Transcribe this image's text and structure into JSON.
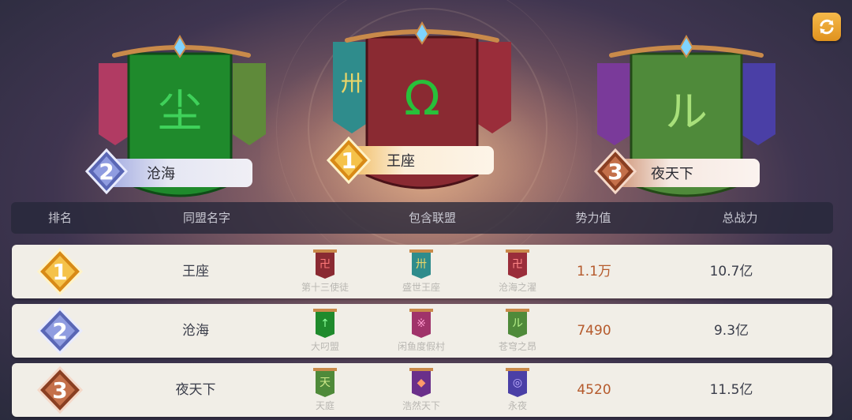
{
  "podium": [
    {
      "rank": "2",
      "name": "沧海",
      "main_glyph": "尘",
      "main_color": "#1f8a2c",
      "glyph_color": "#3fd15a",
      "side_left_color": "#b13b63",
      "side_right_color": "#5f8a3a"
    },
    {
      "rank": "1",
      "name": "王座",
      "main_glyph": "Ω",
      "main_color": "#8a2a32",
      "glyph_color": "#28c03a",
      "side_left_color": "#2f8c8c",
      "side_right_color": "#9a2d3a"
    },
    {
      "rank": "3",
      "name": "夜天下",
      "main_glyph": "ル",
      "main_color": "#4f8a3a",
      "glyph_color": "#a8e07a",
      "side_left_color": "#7a3a9a",
      "side_right_color": "#4a3fa6"
    }
  ],
  "table": {
    "headers": {
      "rank": "排名",
      "alliance_name": "同盟名字",
      "members": "包含联盟",
      "power": "势力值",
      "combat": "总战力"
    },
    "rows": [
      {
        "rank": "1",
        "name": "王座",
        "power": "1.1万",
        "combat": "10.7亿",
        "members": [
          {
            "label": "第十三使徒",
            "color": "#8a2a32",
            "glyph_color": "#ff7a7a"
          },
          {
            "label": "盛世王座",
            "color": "#2f8c8c",
            "glyph_color": "#e7d46a"
          },
          {
            "label": "沧海之濯",
            "color": "#9a2d3a",
            "glyph_color": "#ff8888"
          }
        ]
      },
      {
        "rank": "2",
        "name": "沧海",
        "power": "7490",
        "combat": "9.3亿",
        "members": [
          {
            "label": "大叼盟",
            "color": "#1f8a2c",
            "glyph_color": "#8cff9a"
          },
          {
            "label": "闲鱼度假村",
            "color": "#a0336a",
            "glyph_color": "#ff9ad0"
          },
          {
            "label": "苍穹之昂",
            "color": "#4f8a3a",
            "glyph_color": "#b6f08a"
          }
        ]
      },
      {
        "rank": "3",
        "name": "夜天下",
        "power": "4520",
        "combat": "11.5亿",
        "members": [
          {
            "label": "天庭",
            "color": "#4f8a3a",
            "glyph_color": "#cfe98a"
          },
          {
            "label": "浩然天下",
            "color": "#6a2f8a",
            "glyph_color": "#ff9a6a"
          },
          {
            "label": "永夜",
            "color": "#4a3fa6",
            "glyph_color": "#c0b0ff"
          }
        ]
      }
    ]
  },
  "colors": {
    "gold": "#e8a42a",
    "silver": "#7b86c8",
    "bronze": "#b0603a"
  }
}
